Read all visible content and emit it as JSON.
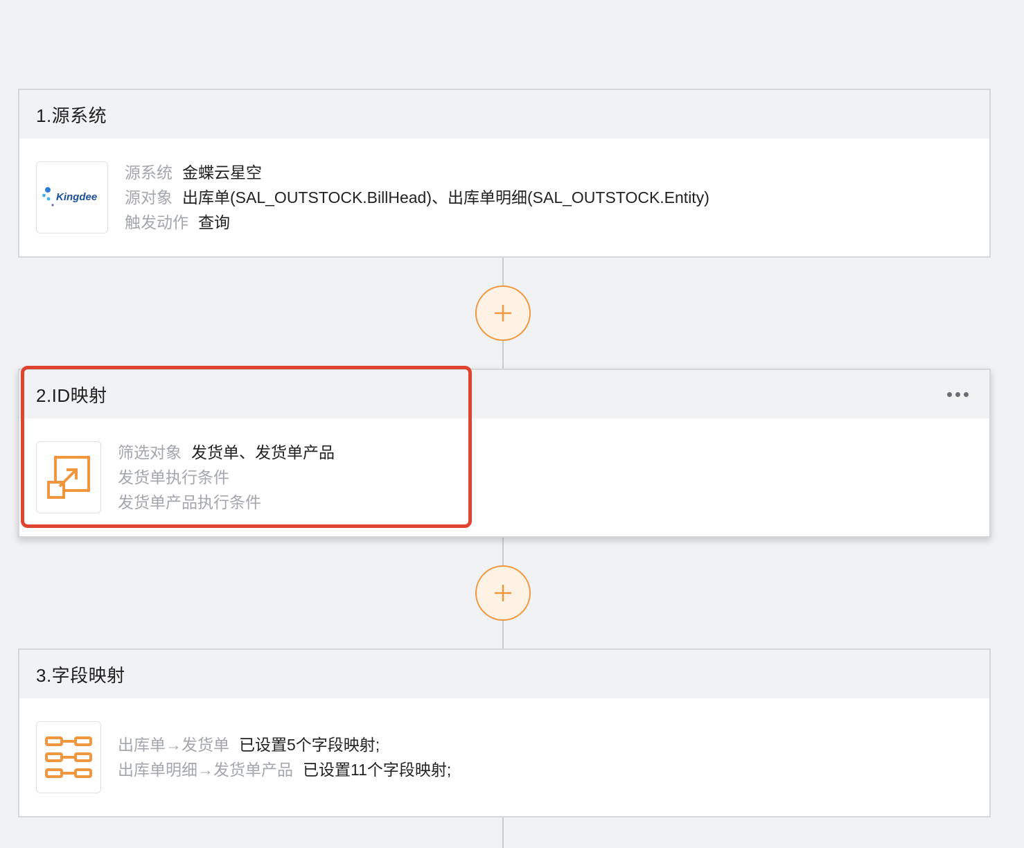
{
  "steps": [
    {
      "title": "1.源系统",
      "icon": "kingdee-logo",
      "logo_text": "Kingdee",
      "rows": [
        {
          "label": "源系统",
          "value": "金蝶云星空"
        },
        {
          "label": "源对象",
          "value": "出库单(SAL_OUTSTOCK.BillHead)、出库单明细(SAL_OUTSTOCK.Entity)"
        },
        {
          "label": "触发动作",
          "value": "查询"
        }
      ]
    },
    {
      "title": "2.ID映射",
      "icon": "id-mapping-icon",
      "highlighted": true,
      "rows": [
        {
          "label": "筛选对象",
          "value": "发货单、发货单产品"
        },
        {
          "label": "发货单执行条件",
          "value": ""
        },
        {
          "label": "发货单产品执行条件",
          "value": ""
        }
      ]
    },
    {
      "title": "3.字段映射",
      "icon": "field-mapping-icon",
      "rows": [
        {
          "label": "出库单→发货单",
          "value": "已设置5个字段映射;"
        },
        {
          "label": "出库单明细→发货单产品",
          "value": "已设置11个字段映射;"
        }
      ]
    }
  ],
  "add_button_icon": "plus-icon",
  "more_icon": "more-dots-icon",
  "colors": {
    "accent": "#ef963f",
    "highlight": "#e0442e",
    "background": "#f1f2f4",
    "label": "#a3a6ab",
    "kingdee_blue": "#1c4f9c"
  }
}
